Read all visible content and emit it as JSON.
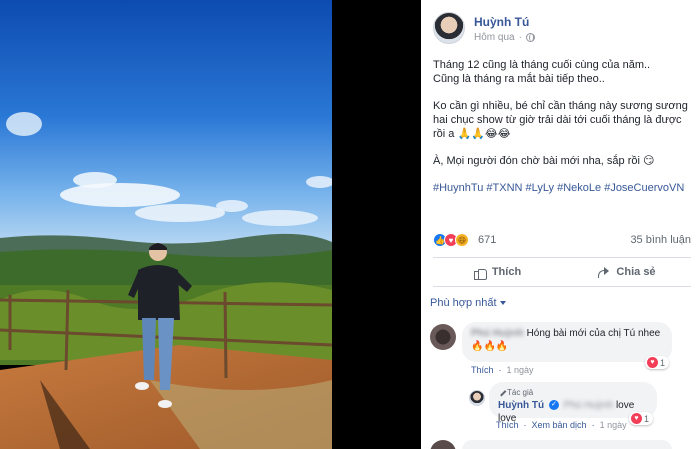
{
  "post": {
    "author": "Huỳnh Tú",
    "time": "Hôm qua",
    "privacy_icon": "globe-icon",
    "paragraphs": [
      [
        "Tháng 12 cũng là tháng cuối cùng của năm..",
        "Cũng là tháng ra mắt bài tiếp theo.."
      ],
      [
        "Ko cần gì nhiều, bé chỉ cần tháng này sương sương hai chục show từ giờ trải dài tới cuối tháng là được rồi a 🙏🙏😂😂"
      ],
      [
        "À, Mọi người đón chờ bài mới nha, sắp rồi 😏"
      ]
    ],
    "hashtags": "#HuynhTu #TXNN #LyLy #NekoLe #JoseCuervoVN"
  },
  "stats": {
    "reaction_count": "671",
    "comments": "35 bình luận",
    "reaction_icons": [
      "like",
      "love",
      "haha"
    ]
  },
  "actions": {
    "like": "Thích",
    "share": "Chia sẻ"
  },
  "sort": {
    "label": "Phù hợp nhất"
  },
  "comments": [
    {
      "name": "Phú Huỳnh",
      "text": "Hóng bài mới của chị Tú nhee",
      "emoji": "🔥🔥🔥",
      "like_label": "Thích",
      "time": "1 ngày",
      "reactions": "1",
      "reply": {
        "tag": "Tác giả",
        "name": "Huỳnh Tú",
        "mention": "Phú Huỳnh",
        "text": "love love",
        "like_label": "Thích",
        "translate": "Xem bản dịch",
        "time": "1 ngày",
        "reactions": "1"
      }
    }
  ],
  "colors": {
    "link": "#385898",
    "like_blue": "#1877f2",
    "love_red": "#f33e58"
  }
}
